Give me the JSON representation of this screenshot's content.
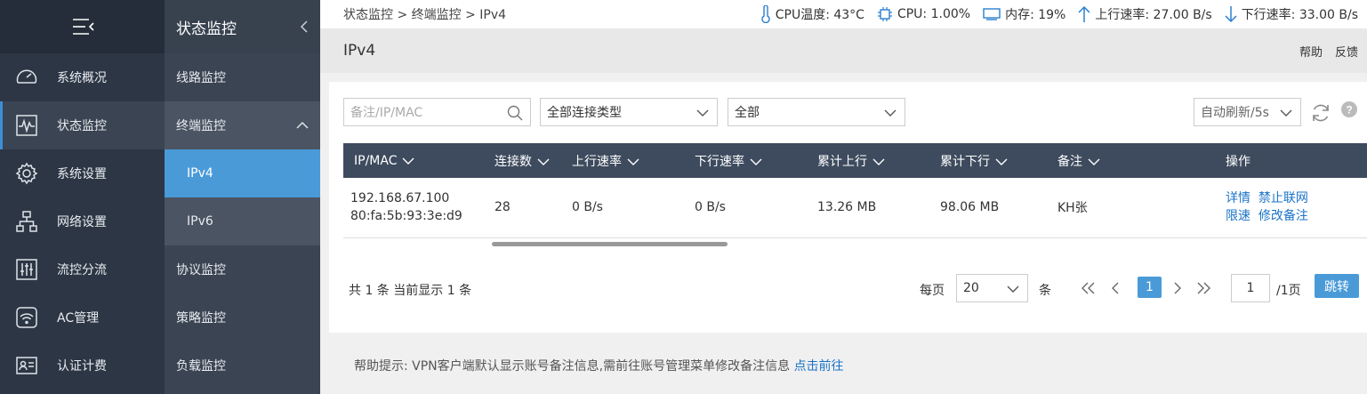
{
  "nav_main": {
    "items": [
      {
        "label": "系统概况",
        "icon": "gauge-icon"
      },
      {
        "label": "状态监控",
        "icon": "monitor-pulse-icon",
        "active": true
      },
      {
        "label": "系统设置",
        "icon": "gear-icon"
      },
      {
        "label": "网络设置",
        "icon": "network-icon"
      },
      {
        "label": "流控分流",
        "icon": "sliders-icon"
      },
      {
        "label": "AC管理",
        "icon": "wifi-icon"
      },
      {
        "label": "认证计费",
        "icon": "id-card-icon"
      }
    ]
  },
  "nav_sub": {
    "title": "状态监控",
    "items": [
      {
        "label": "线路监控"
      },
      {
        "label": "终端监控",
        "open": true
      },
      {
        "label": "IPv4",
        "sub": true,
        "active": true
      },
      {
        "label": "IPv6",
        "sub": true
      },
      {
        "label": "协议监控"
      },
      {
        "label": "策略监控"
      },
      {
        "label": "负载监控"
      }
    ]
  },
  "breadcrumb": "状态监控 > 终端监控 > IPv4",
  "stats": {
    "cpu_temp": "CPU温度: 43°C",
    "cpu": "CPU: 1.00%",
    "mem": "内存: 19%",
    "up": "上行速率: 27.00 B/s",
    "down": "下行速率: 33.00 B/s"
  },
  "page_title": "IPv4",
  "header_links": {
    "help": "帮助",
    "feedback": "反馈"
  },
  "filters": {
    "search_placeholder": "备注/IP/MAC",
    "conn_type": "全部连接类型",
    "scope": "全部",
    "refresh": "自动刷新/5s"
  },
  "table": {
    "headers": [
      "IP/MAC",
      "连接数",
      "上行速率",
      "下行速率",
      "累计上行",
      "累计下行",
      "备注",
      "操作"
    ],
    "rows": [
      {
        "ip": "192.168.67.100",
        "mac": "80:fa:5b:93:3e:d9",
        "conns": "28",
        "up": "0 B/s",
        "down": "0 B/s",
        "total_up": "13.26 MB",
        "total_down": "98.06 MB",
        "note": "KH张",
        "actions": [
          "详情",
          "禁止联网",
          "限速",
          "修改备注"
        ]
      }
    ]
  },
  "pager": {
    "summary": "共 1 条 当前显示 1 条",
    "per_page_label": "每页",
    "per_page": "20",
    "unit": "条",
    "current": "1",
    "page_input": "1",
    "total_pages": "/1页",
    "jump": "跳转"
  },
  "footer": {
    "text": "帮助提示:  VPN客户端默认显示账号备注信息,需前往账号管理菜单修改备注信息",
    "link": "点击前往"
  },
  "colors": {
    "accent": "#4a9ad8",
    "nav_bg": "#2c3644",
    "header_bg": "#3e4b5e",
    "link": "#1a73c8"
  }
}
